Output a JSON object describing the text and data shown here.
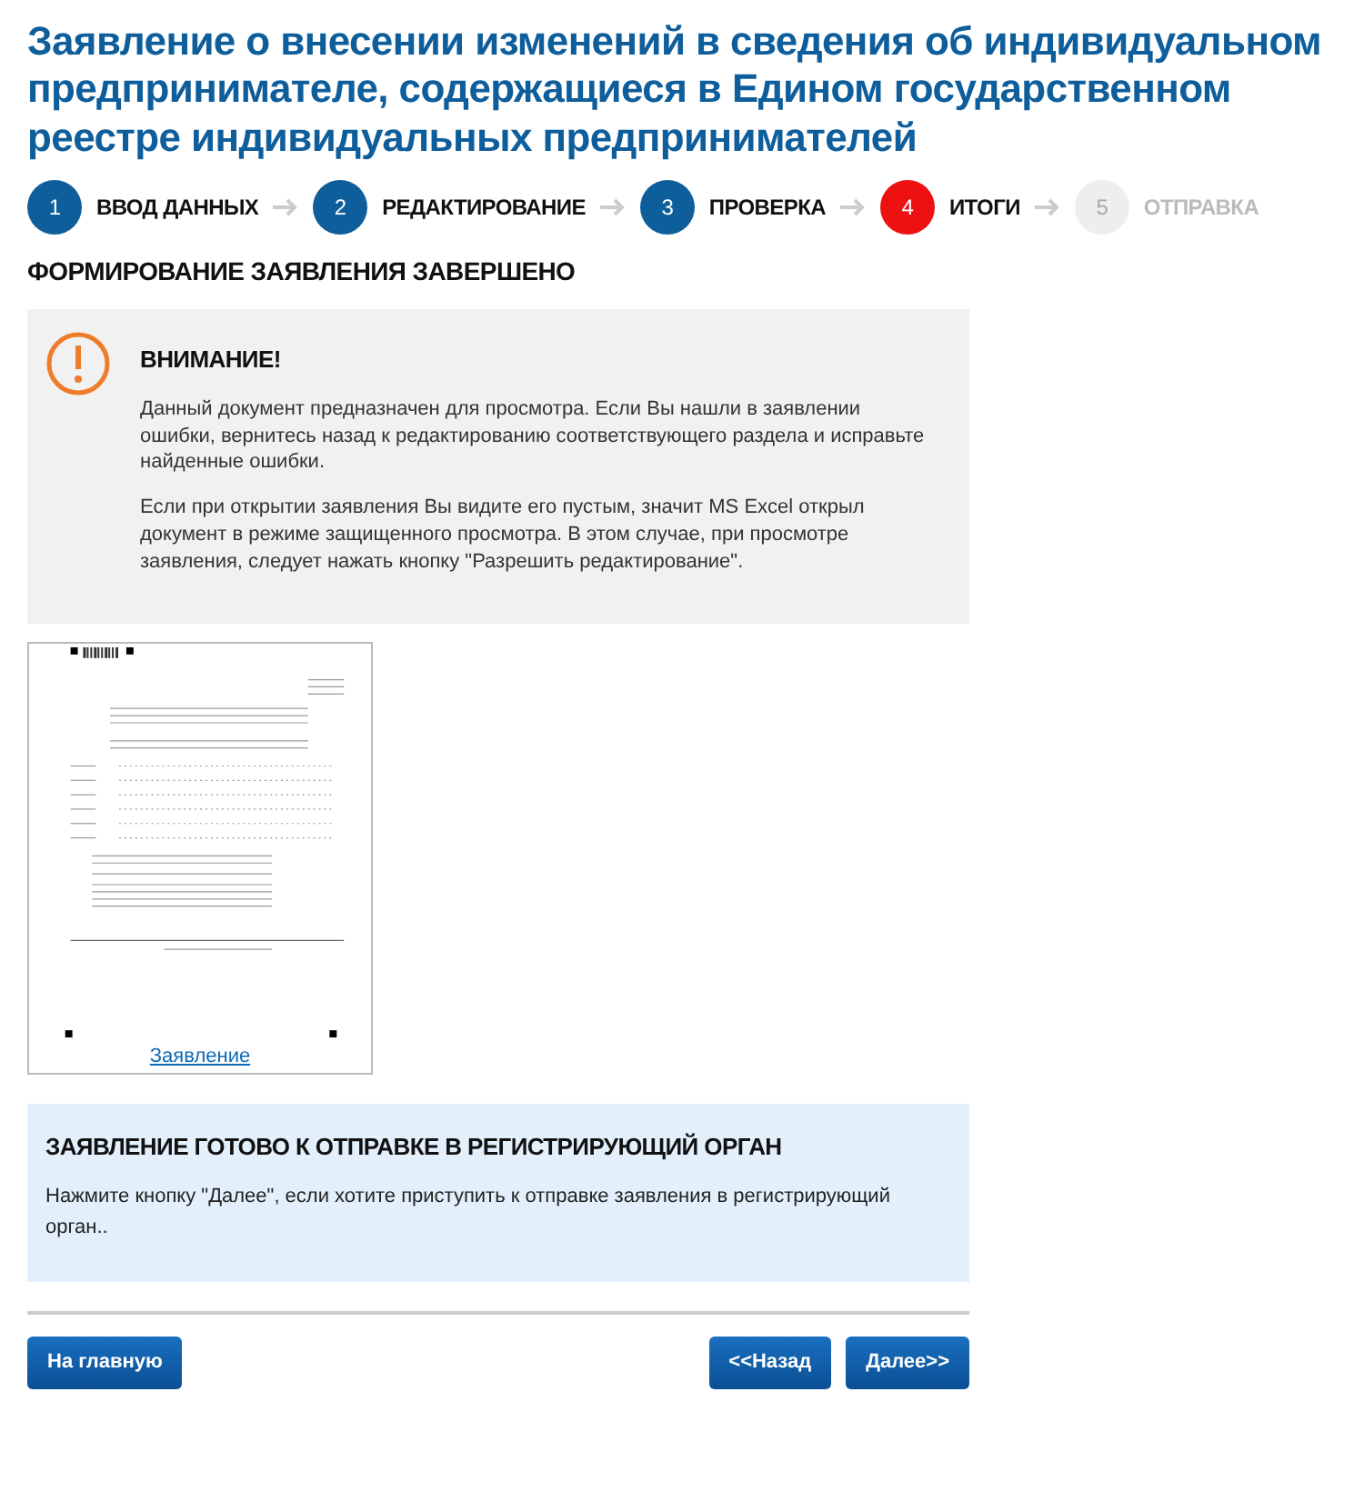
{
  "title": "Заявление о внесении изменений в сведения об индивидуальном предпринимателе, содержащиеся в Едином государственном реестре индивидуальных предпринимателей",
  "steps": [
    {
      "number": "1",
      "label": "ВВОД ДАННЫХ",
      "selected": false,
      "disabled": false
    },
    {
      "number": "2",
      "label": "РЕДАКТИРОВАНИЕ",
      "selected": false,
      "disabled": false
    },
    {
      "number": "3",
      "label": "ПРОВЕРКА",
      "selected": false,
      "disabled": false
    },
    {
      "number": "4",
      "label": "ИТОГИ",
      "selected": true,
      "disabled": false
    },
    {
      "number": "5",
      "label": "ОТПРАВКА",
      "selected": false,
      "disabled": true
    }
  ],
  "section_heading": "ФОРМИРОВАНИЕ ЗАЯВЛЕНИЯ ЗАВЕРШЕНО",
  "warning": {
    "title": "ВНИМАНИЕ!",
    "paragraphs": [
      "Данный документ предназначен для просмотра. Если Вы нашли в заявлении ошибки, вернитесь назад к редактированию соответствующего раздела и исправьте найденные ошибки.",
      "Если при открытии заявления Вы видите его пустым, значит MS Excel открыл документ в режиме защищенного просмотра. В этом случае, при просмотре заявления, следует нажать кнопку \"Разрешить редактирование\"."
    ]
  },
  "document": {
    "link": "Заявление"
  },
  "ready": {
    "title": "ЗАЯВЛЕНИЕ ГОТОВО К ОТПРАВКЕ В РЕГИСТРИРУЮЩИЙ ОРГАН",
    "text": "Нажмите кнопку \"Далее\", если хотите приступить к отправке заявления в регистрирующий орган.."
  },
  "buttons": {
    "home": "На главную",
    "back": "<<Назад",
    "next": "Далее>>"
  }
}
